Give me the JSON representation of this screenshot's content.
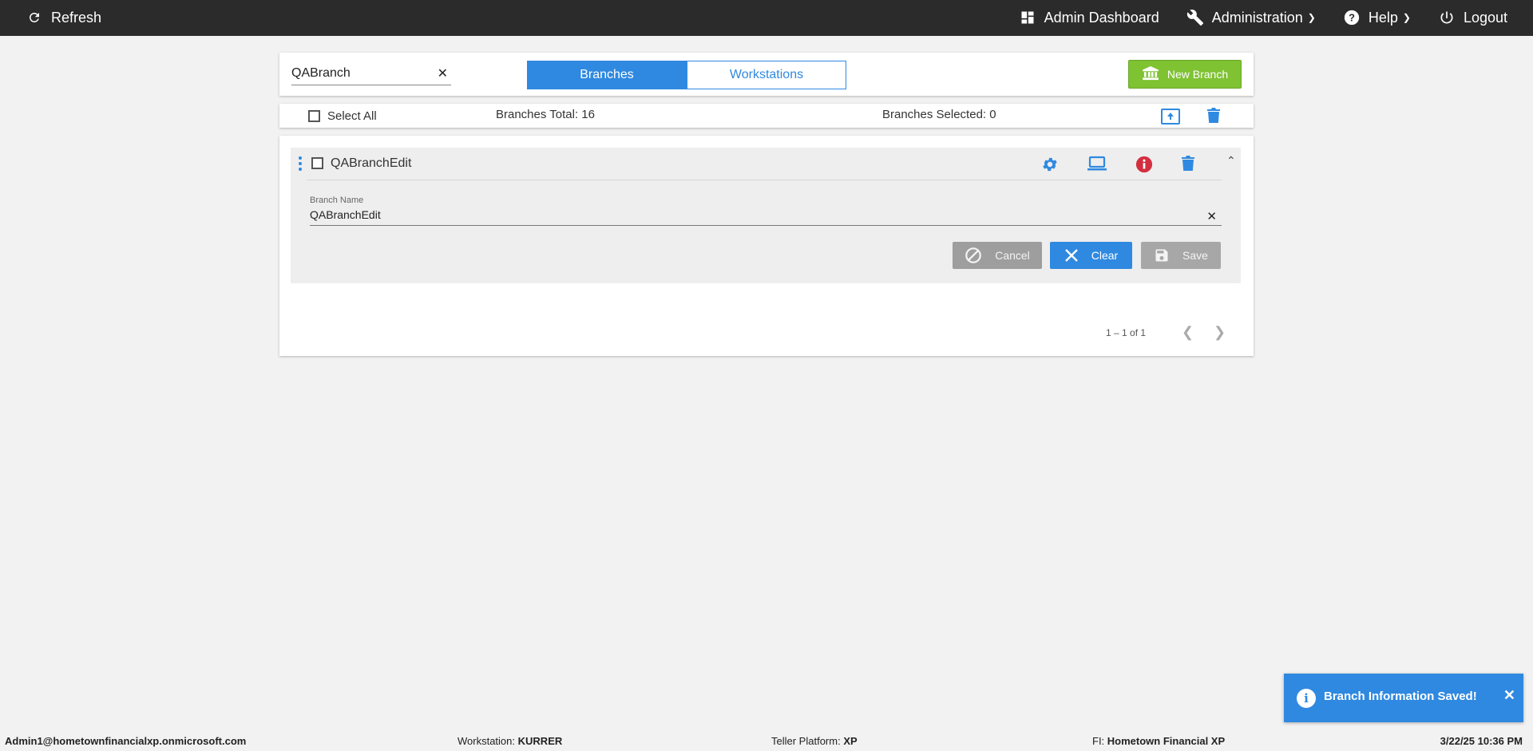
{
  "topbar": {
    "refresh_label": "Refresh",
    "admin_dashboard_label": "Admin Dashboard",
    "administration_label": "Administration",
    "help_label": "Help",
    "logout_label": "Logout"
  },
  "toolbar": {
    "search_value": "QABranch",
    "tabs": [
      {
        "label": "Branches",
        "active": true
      },
      {
        "label": "Workstations",
        "active": false
      }
    ],
    "new_branch_label": "New Branch"
  },
  "summary": {
    "select_all_label": "Select All",
    "branches_total": "Branches Total: 16",
    "branches_selected": "Branches Selected: 0"
  },
  "branch": {
    "name": "QABranchEdit",
    "field_label": "Branch Name",
    "field_value": "QABranchEdit",
    "cancel_label": "Cancel",
    "clear_label": "Clear",
    "save_label": "Save"
  },
  "pager": {
    "range": "1 – 1 of 1"
  },
  "toast": {
    "message": "Branch Information Saved!"
  },
  "status": {
    "user": "Admin1@hometownfinancialxp.onmicrosoft.com",
    "workstation_label": "Workstation:",
    "workstation_value": "KURRER",
    "platform_label": "Teller Platform:",
    "platform_value": "XP",
    "fi_label": "FI:",
    "fi_value": "Hometown Financial XP",
    "datetime": "3/22/25 10:36 PM"
  },
  "colors": {
    "accent": "#2f89e0",
    "success": "#7fc232",
    "danger": "#d32f3f",
    "topbar": "#2b2b2b"
  }
}
